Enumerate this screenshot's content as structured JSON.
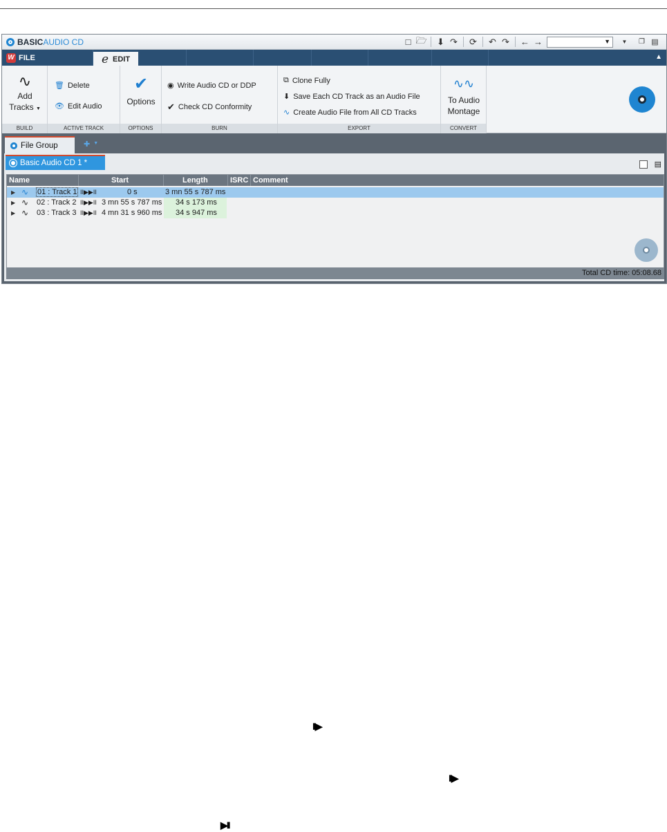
{
  "titlebar": {
    "title_prefix": "BASIC",
    "title_suffix": "AUDIO CD",
    "combo_value": ""
  },
  "tabs": {
    "file": "FILE",
    "edit": "EDIT"
  },
  "ribbon": {
    "build": {
      "label": "BUILD",
      "add_tracks": "Add",
      "add_tracks2": "Tracks"
    },
    "active_track": {
      "label": "ACTIVE TRACK",
      "delete": "Delete",
      "edit_audio": "Edit Audio"
    },
    "options": {
      "label": "OPTIONS",
      "options": "Options"
    },
    "burn": {
      "label": "BURN",
      "write": "Write Audio CD or DDP",
      "check": "Check CD Conformity"
    },
    "export": {
      "label": "EXPORT",
      "clone": "Clone Fully",
      "save_each": "Save Each CD Track as an Audio File",
      "create": "Create Audio File from All CD Tracks"
    },
    "convert": {
      "label": "CONVERT",
      "to_audio": "To Audio",
      "montage": "Montage"
    }
  },
  "file_group": {
    "tab_label": "File Group"
  },
  "document": {
    "tab_label": "Basic Audio CD 1 *",
    "columns": {
      "name": "Name",
      "start": "Start",
      "length": "Length",
      "isrc": "ISRC",
      "comment": "Comment"
    },
    "tracks": [
      {
        "name": "01 : Track 1",
        "transport": "II▶▶II",
        "start": "0 s",
        "length": "3 mn 55 s 787 ms"
      },
      {
        "name": "02 : Track 2",
        "transport": "II▶▶II",
        "start": "3 mn 55 s 787 ms",
        "length": "34 s 173 ms"
      },
      {
        "name": "03 : Track 3",
        "transport": "II▶▶II",
        "start": "4 mn 31 s 960 ms",
        "length": "34 s 947 ms"
      }
    ],
    "status": "Total CD time: 05:08.68"
  },
  "glyphs": {
    "g1": "II▶",
    "g2": "II▶",
    "g3": "▶II"
  },
  "colors": {
    "accent": "#2f96df",
    "tabbar": "#2a4f73",
    "selection": "#9cc9ee"
  }
}
